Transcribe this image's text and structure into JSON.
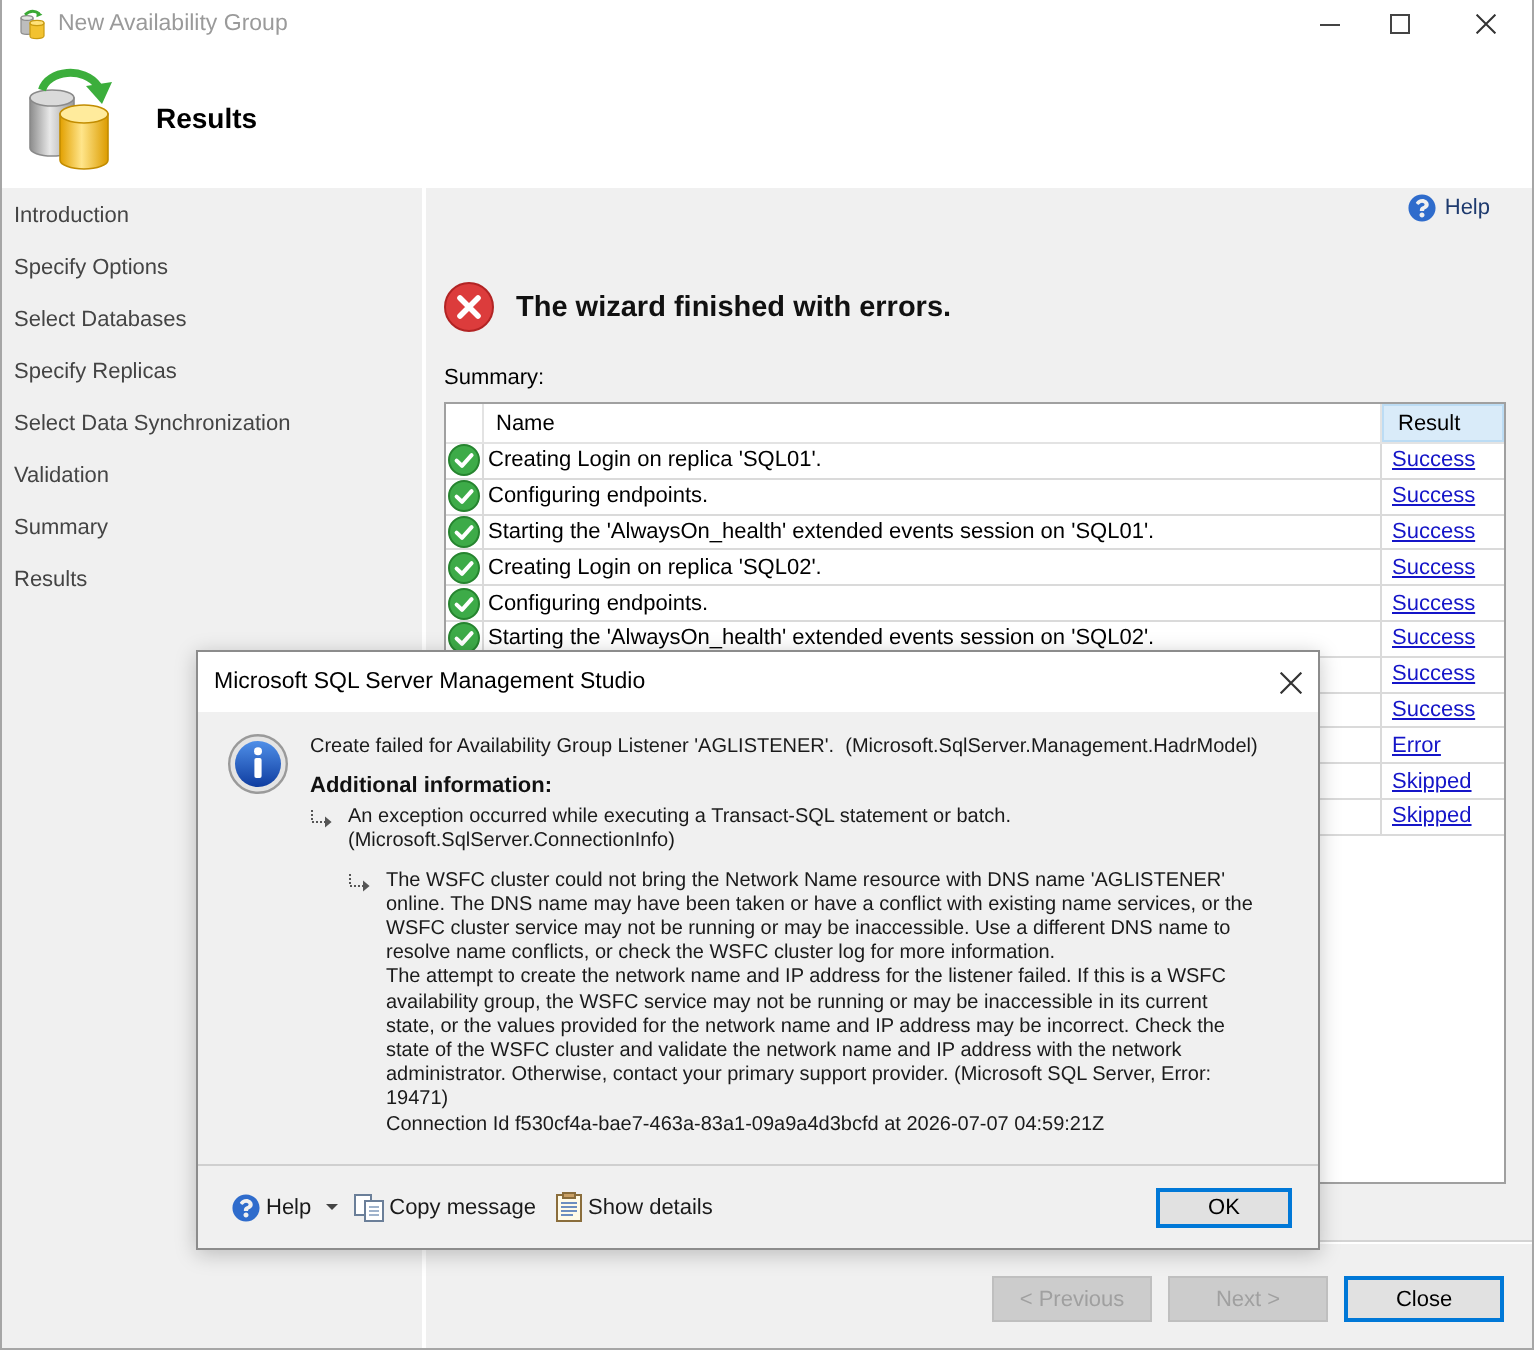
{
  "window": {
    "title": "New Availability Group",
    "active": false
  },
  "header": {
    "title": "Results"
  },
  "sidebar": {
    "items": [
      {
        "label": "Introduction"
      },
      {
        "label": "Specify Options"
      },
      {
        "label": "Select Databases"
      },
      {
        "label": "Specify Replicas"
      },
      {
        "label": "Select Data Synchronization"
      },
      {
        "label": "Validation"
      },
      {
        "label": "Summary"
      },
      {
        "label": "Results"
      }
    ]
  },
  "help_link": {
    "label": "Help"
  },
  "outcome": {
    "kind": "error",
    "message": "The wizard finished with errors."
  },
  "summary": {
    "label": "Summary:",
    "table": {
      "columns": [
        {
          "label": "Name",
          "highlighted": false
        },
        {
          "label": "Result",
          "highlighted": true
        }
      ],
      "rows": [
        {
          "kind": "success",
          "name": "Creating Login on replica 'SQL01'.",
          "result": "Success"
        },
        {
          "kind": "success",
          "name": "Configuring endpoints.",
          "result": "Success"
        },
        {
          "kind": "success",
          "name": "Starting the 'AlwaysOn_health' extended events session on 'SQL01'.",
          "result": "Success"
        },
        {
          "kind": "success",
          "name": "Creating Login on replica 'SQL02'.",
          "result": "Success"
        },
        {
          "kind": "success",
          "name": "Configuring endpoints.",
          "result": "Success"
        },
        {
          "kind": "success",
          "name": "Starting the 'AlwaysOn_health' extended events session on 'SQL02'.",
          "result": "Success"
        },
        {
          "result": "Success"
        },
        {
          "result": "Success"
        },
        {
          "result": "Error"
        },
        {
          "result": "Skipped"
        },
        {
          "result": "Skipped"
        }
      ]
    }
  },
  "buttons": [
    {
      "label": "< Previous",
      "disabled": true,
      "default": false
    },
    {
      "label": "Next >",
      "disabled": true,
      "default": false
    },
    {
      "label": "Close",
      "disabled": false,
      "default": true
    }
  ],
  "dialog": {
    "title": "Microsoft SQL Server Management Studio",
    "kind": "info",
    "message": "Create failed for Availability Group Listener 'AGLISTENER'.  (Microsoft.SqlServer.Management.HadrModel)",
    "additional_label": "Additional information:",
    "details": [
      {
        "text": "An exception occurred while executing a Transact-SQL statement or batch.\n(Microsoft.SqlServer.ConnectionInfo)",
        "children": [
          {
            "text": "The WSFC cluster could not bring the Network Name resource with DNS name 'AGLISTENER'\nonline. The DNS name may have been taken or have a conflict with existing name services, or the\nWSFC cluster service may not be running or may be inaccessible. Use a different DNS name to\nresolve name conflicts, or check the WSFC cluster log for more information.\nThe attempt to create the network name and IP address for the listener failed. If this is a WSFC\navailability group, the WSFC service may not be running or may be inaccessible in its current\nstate, or the values provided for the network name and IP address may be incorrect. Check the\nstate of the WSFC cluster and validate the network name and IP address with the network\nadministrator. Otherwise, contact your primary support provider. (Microsoft SQL Server, Error:\n19471)\nConnection Id f530cf4a-bae7-463a-83a1-09a9a4d3bcfd at 2026-07-07 04:59:21Z"
          }
        ]
      }
    ],
    "footer": [
      {
        "kind": "help",
        "label": "Help",
        "dropdown": true
      },
      {
        "kind": "copy",
        "label": "Copy message",
        "dropdown": false
      },
      {
        "kind": "details",
        "label": "Show details",
        "dropdown": false
      }
    ],
    "ok": {
      "label": "OK",
      "default": true
    }
  }
}
